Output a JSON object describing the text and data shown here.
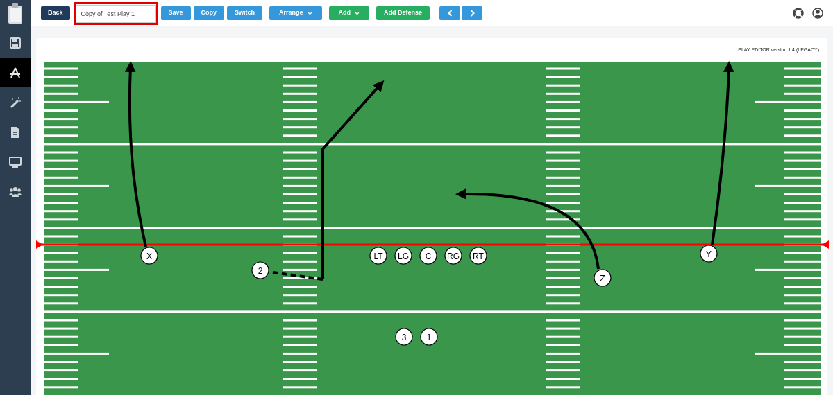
{
  "sidebar": {
    "items": [
      {
        "kind": "save",
        "selected": false
      },
      {
        "kind": "editor",
        "selected": true
      },
      {
        "kind": "wand",
        "selected": false
      },
      {
        "kind": "document",
        "selected": false
      },
      {
        "kind": "monitor",
        "selected": false
      },
      {
        "kind": "team",
        "selected": false
      }
    ]
  },
  "toolbar": {
    "back": "Back",
    "play_name": "Copy of Test Play 1",
    "buttons": [
      {
        "label": "Save",
        "kind": "blue",
        "dropdown": false
      },
      {
        "label": "Copy",
        "kind": "blue",
        "dropdown": false
      },
      {
        "label": "Switch",
        "kind": "blue",
        "dropdown": false
      },
      {
        "label": "Arrange",
        "kind": "blue",
        "dropdown": true
      },
      {
        "label": "Add",
        "kind": "green",
        "dropdown": true
      },
      {
        "label": "Add Defense",
        "kind": "green",
        "dropdown": false
      }
    ]
  },
  "editor": {
    "version": "PLAY EDITOR version 1.4 (LEGACY)",
    "players": [
      {
        "label": "X"
      },
      {
        "label": "2"
      },
      {
        "label": "LT"
      },
      {
        "label": "LG"
      },
      {
        "label": "C"
      },
      {
        "label": "RG"
      },
      {
        "label": "RT"
      },
      {
        "label": "Z"
      },
      {
        "label": "Y"
      },
      {
        "label": "3"
      },
      {
        "label": "1"
      }
    ]
  }
}
